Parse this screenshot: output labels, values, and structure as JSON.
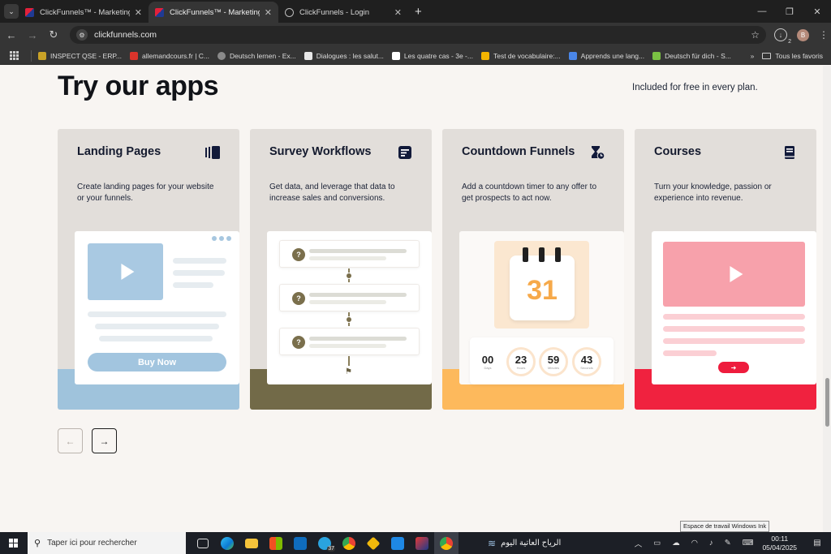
{
  "browser": {
    "tabs": [
      {
        "title": "ClickFunnels™ - Marketing Funnels",
        "active": false
      },
      {
        "title": "ClickFunnels™ - Marketing Funnels",
        "active": true
      },
      {
        "title": "ClickFunnels - Login",
        "active": false
      }
    ],
    "new_tab_glyph": "+",
    "url": "clickfunnels.com",
    "profile_initial": "B",
    "download_count": "2",
    "bookmarks": [
      {
        "label": "INSPECT QSE - ERP...",
        "color": "#c9a227"
      },
      {
        "label": "allemandcours.fr | C...",
        "color": "#d9342b"
      },
      {
        "label": "Deutsch lernen - Ex...",
        "color": "#8a8a8a"
      },
      {
        "label": "Dialogues : les salut...",
        "color": "#e8e8e8"
      },
      {
        "label": "Les quatre cas - 3e -...",
        "color": "#ffffff"
      },
      {
        "label": "Test de vocabulaire:...",
        "color": "#f4b400"
      },
      {
        "label": "Apprends une lang...",
        "color": "#4a86e8"
      },
      {
        "label": "Deutsch für dich - S...",
        "color": "#7ac143"
      }
    ],
    "bookmarks_all": "Tous les favoris"
  },
  "page": {
    "headline": "Try our apps",
    "subline": "Included for free in every plan.",
    "cards": [
      {
        "title": "Landing Pages",
        "desc": "Create landing pages for your website or your funnels.",
        "icon": "pages-stack-icon",
        "band_color": "#9fc3dc",
        "cta": "Buy Now"
      },
      {
        "title": "Survey Workflows",
        "desc": "Get data, and leverage that data to increase sales and conversions.",
        "icon": "form-icon",
        "band_color": "#726a48"
      },
      {
        "title": "Countdown Funnels",
        "desc": "Add a countdown timer to any offer to get prospects to act now.",
        "icon": "hourglass-icon",
        "band_color": "#fdb95c",
        "calendar_day": "31",
        "timer": [
          {
            "value": "00",
            "label": "Days"
          },
          {
            "value": "23",
            "label": "Hours"
          },
          {
            "value": "59",
            "label": "Minutes"
          },
          {
            "value": "43",
            "label": "Seconds"
          }
        ]
      },
      {
        "title": "Courses",
        "desc": "Turn your knowledge, passion or experience into revenue.",
        "icon": "book-icon",
        "band_color": "#f0223f"
      }
    ],
    "prev_glyph": "←",
    "next_glyph": "→",
    "tooltip": "Espace de travail Windows Ink"
  },
  "taskbar": {
    "search_placeholder": "Taper ici pour rechercher",
    "telegram_count": "37",
    "weather_text": "الرياح العاتية اليوم",
    "time": "00:11",
    "date": "05/04/2025"
  }
}
